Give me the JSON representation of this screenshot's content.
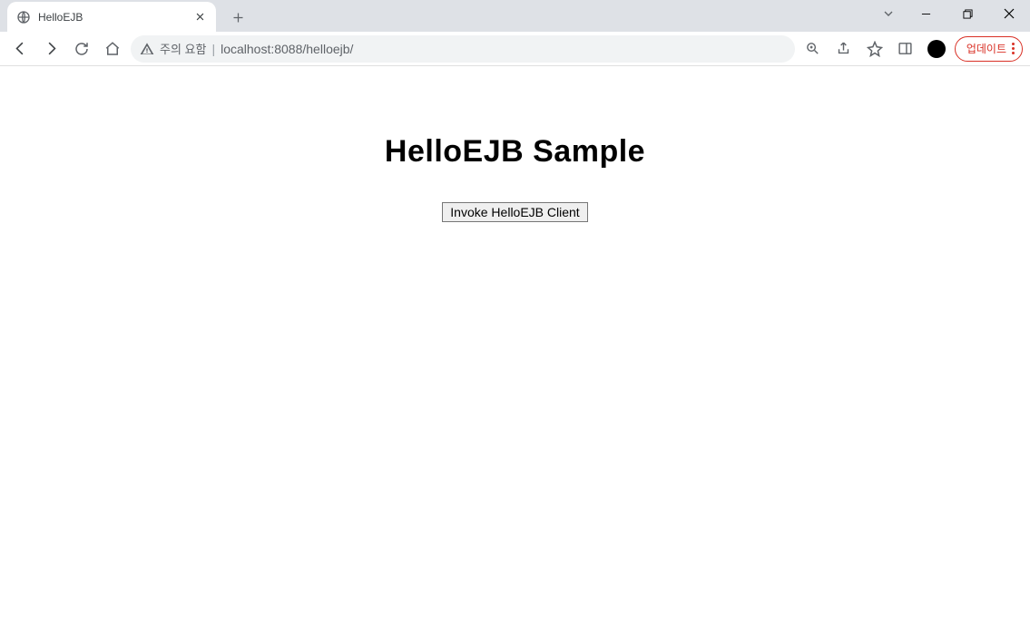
{
  "browser": {
    "tab_title": "HelloEJB",
    "security_label": "주의 요함",
    "url": "localhost:8088/helloejb/",
    "update_label": "업데이트"
  },
  "page": {
    "heading": "HelloEJB Sample",
    "button_label": "Invoke HelloEJB Client"
  }
}
